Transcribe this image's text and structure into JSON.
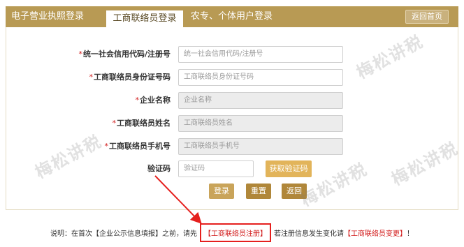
{
  "tabs": [
    {
      "label": "电子营业执照登录"
    },
    {
      "label": "工商联络员登录"
    },
    {
      "label": "农专、个体用户登录"
    }
  ],
  "back_home": "返回首页",
  "form": {
    "fields": [
      {
        "label": "统一社会信用代码/注册号",
        "placeholder": "统一社会信用代码/注册号",
        "required": true
      },
      {
        "label": "工商联络员身份证号码",
        "placeholder": "工商联络员身份证号码",
        "required": true
      },
      {
        "label": "企业名称",
        "placeholder": "企业名称",
        "required": true
      },
      {
        "label": "工商联络员姓名",
        "placeholder": "工商联络员姓名",
        "required": true
      },
      {
        "label": "工商联络员手机号",
        "placeholder": "工商联络员手机号",
        "required": true
      }
    ],
    "captcha_label": "验证码",
    "captcha_placeholder": "验证码",
    "get_code_button": "获取验证码",
    "required_mark": "*"
  },
  "actions": {
    "login": "登录",
    "reset": "重置",
    "back": "返回"
  },
  "note": {
    "prefix": "说明：在首次【企业公示信息填报】之前，请先",
    "link_register": "【工商联络员注册】",
    "middle": "若注册信息发生变化请",
    "link_change": "【工商联络员变更】",
    "suffix": "！"
  },
  "watermark": "梅松讲税"
}
